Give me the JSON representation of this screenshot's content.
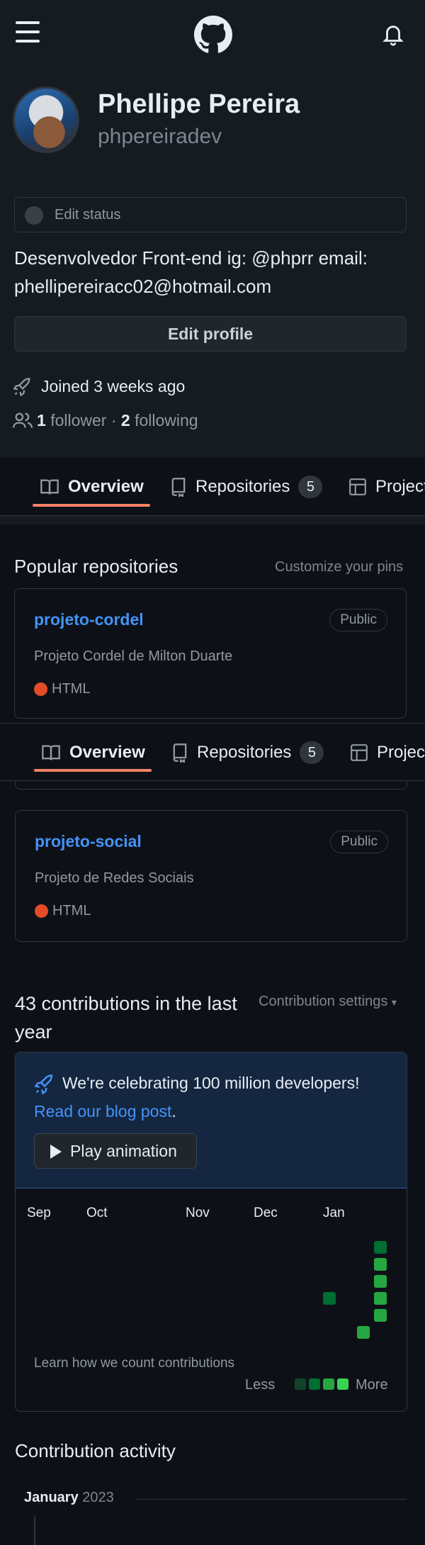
{
  "header": {
    "menu_icon": "hamburger-icon",
    "logo_icon": "github-logo-icon",
    "notifications_icon": "bell-icon"
  },
  "profile": {
    "name": "Phellipe Pereira",
    "login": "phpereiradev",
    "status_label": "Edit status",
    "bio": "Desenvolvedor Front-end ig: @phprr email: phellipereiracc02@hotmail.com",
    "edit_profile_label": "Edit profile",
    "joined": "Joined 3 weeks ago",
    "followers_count": "1",
    "followers_label": "follower",
    "separator": "·",
    "following_count": "2",
    "following_label": "following"
  },
  "tabs": [
    {
      "label": "Overview",
      "icon": "book-icon",
      "active": true
    },
    {
      "label": "Repositories",
      "icon": "repo-icon",
      "count": "5"
    },
    {
      "label": "Projects",
      "icon": "table-icon"
    }
  ],
  "popular": {
    "title": "Popular repositories",
    "customize_label": "Customize your pins",
    "repos": [
      {
        "name": "projeto-cordel",
        "visibility": "Public",
        "description": "Projeto Cordel de Milton Duarte",
        "language": "HTML",
        "language_color": "#e34c26"
      },
      {
        "name": "projeto-social",
        "visibility": "Public",
        "description": "Projeto de Redes Sociais",
        "language": "HTML",
        "language_color": "#e34c26"
      }
    ]
  },
  "contributions": {
    "title": "43 contributions in the last year",
    "settings_label": "Contribution settings",
    "celebration_text": "We're celebrating 100 million developers!",
    "blog_link": "Read our blog post",
    "blog_suffix": ".",
    "play_label": "Play animation",
    "months": [
      "Sep",
      "Oct",
      "Nov",
      "Dec",
      "Jan"
    ],
    "learn_label": "Learn how we count contributions",
    "legend_less": "Less",
    "legend_more": "More",
    "colors": {
      "level1": "#0e4429",
      "level2": "#006d32",
      "level3": "#26a641",
      "level4": "#39d353"
    }
  },
  "activity": {
    "title": "Contribution activity",
    "month": "January",
    "year": "2023"
  }
}
